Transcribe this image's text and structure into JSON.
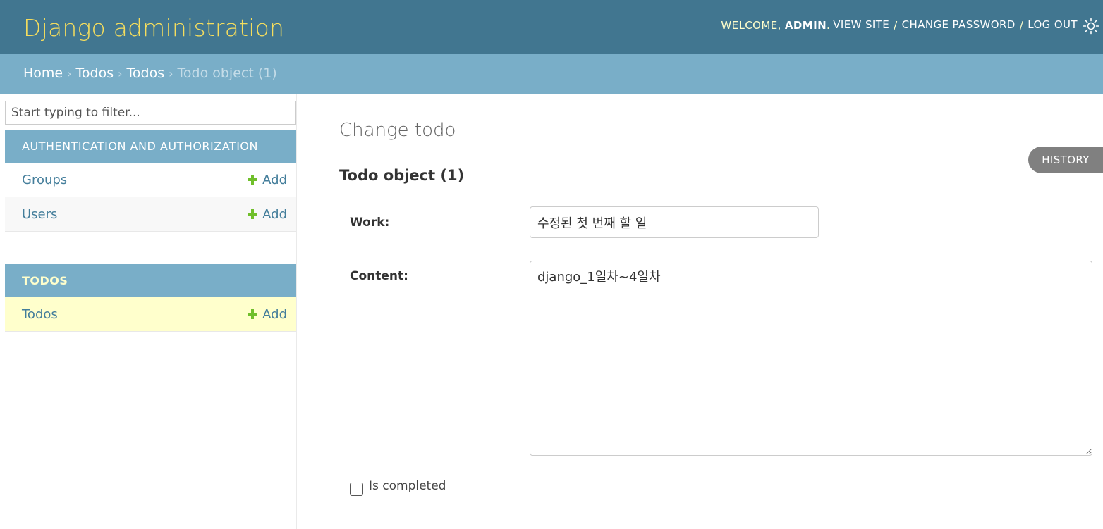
{
  "header": {
    "site_title": "Django administration",
    "welcome_text": "WELCOME,",
    "username": "ADMIN",
    "view_site": "VIEW SITE",
    "change_password": "CHANGE PASSWORD",
    "log_out": "LOG OUT",
    "separator": "/"
  },
  "breadcrumbs": {
    "items": [
      "Home",
      "Todos",
      "Todos"
    ],
    "current": "Todo object (1)",
    "separator": "›"
  },
  "sidebar": {
    "filter_placeholder": "Start typing to filter...",
    "modules": [
      {
        "caption": "AUTHENTICATION AND AUTHORIZATION",
        "models": [
          {
            "name": "Groups",
            "add_label": "Add"
          },
          {
            "name": "Users",
            "add_label": "Add"
          }
        ]
      },
      {
        "caption": "TODOS",
        "models": [
          {
            "name": "Todos",
            "add_label": "Add"
          }
        ]
      }
    ]
  },
  "main": {
    "title": "Change todo",
    "history_label": "HISTORY",
    "object_title": "Todo object (1)",
    "fields": {
      "work_label": "Work:",
      "work_value": "수정된 첫 번째 할 일",
      "content_label": "Content:",
      "content_value": "django_1일차~4일차",
      "is_completed_label": "Is completed",
      "is_completed": false
    }
  },
  "colors": {
    "header_bg": "#417690",
    "breadcrumb_bg": "#79aec8",
    "site_title": "#f5dd5d",
    "link": "#447e9b",
    "add_icon": "#70bf2b",
    "current_row": "#ffffcc"
  }
}
